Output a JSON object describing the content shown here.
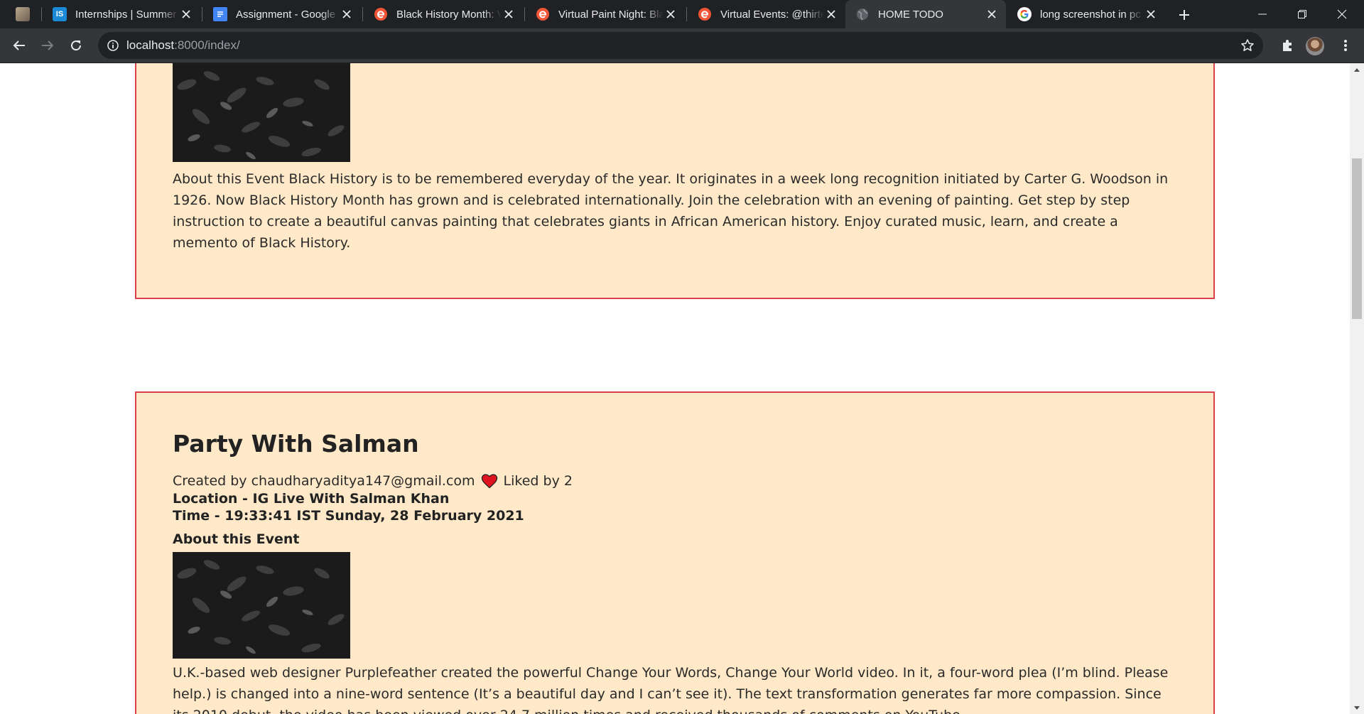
{
  "browser": {
    "tabs": [
      {
        "label": "",
        "favicon": "profile-photo-icon",
        "color": "#8a7a66"
      },
      {
        "label": "Internships | Summer Internships",
        "favicon": "internshala-icon",
        "color": "#1a8ad6",
        "favicon_text": "IS"
      },
      {
        "label": "Assignment - Google Docs",
        "favicon": "google-docs-icon",
        "color": "#4285f4"
      },
      {
        "label": "Black History Month: Virtual Paint Night",
        "favicon": "eventbrite-icon",
        "color": "#f05537"
      },
      {
        "label": "Virtual Paint Night: Black History",
        "favicon": "eventbrite-icon",
        "color": "#f05537"
      },
      {
        "label": "Virtual Events: @thirteen",
        "favicon": "eventbrite-icon",
        "color": "#f05537"
      },
      {
        "label": "HOME TODO",
        "favicon": "globe-icon",
        "color": "#9aa0a6",
        "active": true
      },
      {
        "label": "long screenshot in pc - Google Search",
        "favicon": "google-icon",
        "color": "#4285f4"
      }
    ],
    "url_host": "localhost",
    "url_rest": ":8000/index/"
  },
  "events": [
    {
      "description": "About this Event Black History is to be remembered everyday of the year. It originates in a week long recognition initiated by Carter G. Woodson in 1926. Now Black History Month has grown and is celebrated internationally. Join the celebration with an evening of painting. Get step by step instruction to create a beautiful canvas painting that celebrates giants in African American history. Enjoy curated music, learn, and create a memento of Black History."
    },
    {
      "title": "Party With Salman",
      "created_by": "Created by chaudharyaditya147@gmail.com",
      "liked_by": "Liked by 2",
      "location": "Location - IG Live With Salman Khan",
      "time": "Time - 19:33:41 IST Sunday, 28 February 2021",
      "about_heading": "About this Event",
      "description": "U.K.-based web designer Purplefeather created the powerful Change Your Words, Change Your World video. In it, a four-word plea (I’m blind. Please help.) is changed into a nine-word sentence (It’s a beautiful day and I can’t see it). The text transformation generates far more compassion. Since its 2010 debut, the video has been viewed over 24.7 million times and received thousands of comments on YouTube."
    }
  ],
  "colors": {
    "card_background": "#ffe9c8",
    "card_border": "#d9424a",
    "heart": "#e0141e"
  }
}
